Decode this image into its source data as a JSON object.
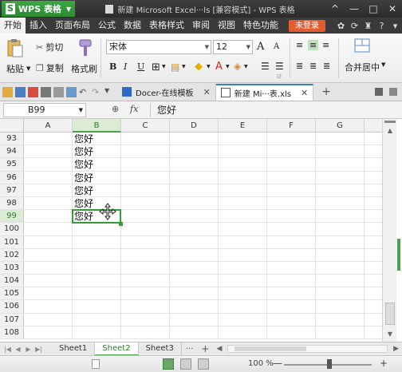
{
  "titlebar": {
    "app_name": "WPS 表格",
    "doc_title": "新建 Microsoft Excel···ls [兼容模式] - WPS 表格",
    "controls": [
      "^",
      "—",
      "□",
      "✕"
    ]
  },
  "menubar": {
    "items": [
      "开始",
      "插入",
      "页面布局",
      "公式",
      "数据",
      "表格样式",
      "审阅",
      "视图",
      "特色功能"
    ],
    "active_index": 0,
    "login_label": "未登录"
  },
  "ribbon": {
    "paste_label": "粘贴",
    "cut_label": "剪切",
    "copy_label": "复制",
    "format_painter_label": "格式刷",
    "font_name": "宋体",
    "font_size": "12",
    "bold": "B",
    "italic": "I",
    "underline": "U",
    "grow_font": "A",
    "shrink_font": "A",
    "merge_label": "合并居中"
  },
  "tabs": {
    "docer_label": "Docer-在线模板",
    "file_tab_label": "新建 Mi···表.xls",
    "new_tab": "+"
  },
  "formula": {
    "cell_ref": "B99",
    "fx": "fx",
    "value": "您好"
  },
  "grid": {
    "columns": [
      "A",
      "B",
      "C",
      "D",
      "E",
      "F",
      "G"
    ],
    "selected_column": "B",
    "rows": [
      {
        "num": "93",
        "b": "您好"
      },
      {
        "num": "94",
        "b": "您好"
      },
      {
        "num": "95",
        "b": "您好"
      },
      {
        "num": "96",
        "b": "您好"
      },
      {
        "num": "97",
        "b": "您好"
      },
      {
        "num": "98",
        "b": "您好"
      },
      {
        "num": "99",
        "b": "您好"
      },
      {
        "num": "100",
        "b": ""
      },
      {
        "num": "101",
        "b": ""
      },
      {
        "num": "102",
        "b": ""
      },
      {
        "num": "103",
        "b": ""
      },
      {
        "num": "104",
        "b": ""
      },
      {
        "num": "105",
        "b": ""
      },
      {
        "num": "106",
        "b": ""
      },
      {
        "num": "107",
        "b": ""
      },
      {
        "num": "108",
        "b": ""
      }
    ],
    "selected_row": "99"
  },
  "sheets": {
    "names": [
      "Sheet1",
      "Sheet2",
      "Sheet3"
    ],
    "active": "Sheet2",
    "more": "···",
    "add": "+"
  },
  "status": {
    "zoom": "100 %",
    "zoom_minus": "—",
    "zoom_plus": "+"
  },
  "colors": {
    "accent_green": "#4aa24a",
    "login_orange": "#e35c2f",
    "titlebar_dark": "#2b2b2b"
  }
}
